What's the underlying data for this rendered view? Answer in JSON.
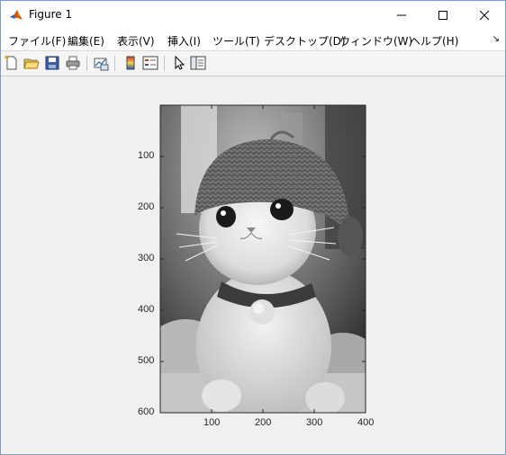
{
  "window": {
    "title": "Figure 1",
    "controls": {
      "minimize": "minimize",
      "maximize": "maximize",
      "close": "close"
    }
  },
  "menu": {
    "items": [
      "ファイル(F)",
      "編集(E)",
      "表示(V)",
      "挿入(I)",
      "ツール(T)",
      "デスクトップ(D)",
      "ウィンドウ(W)",
      "ヘルプ(H)"
    ],
    "overflow_arrow": "↘"
  },
  "toolbar": {
    "icons": [
      "new-figure-icon",
      "open-file-icon",
      "save-icon",
      "print-icon",
      "link-plot-icon",
      "colorbar-icon",
      "legend-icon",
      "pointer-icon",
      "property-editor-icon"
    ]
  },
  "axes": {
    "xticks": [
      "100",
      "200",
      "300",
      "400"
    ],
    "yticks": [
      "100",
      "200",
      "300",
      "400",
      "500",
      "600"
    ],
    "image_description_name": "grayscale-cat-image"
  },
  "colors": {
    "titlebar_bg": "#ffffff",
    "window_border": "#7a9cc6",
    "figure_bg": "#f0f0f0"
  }
}
